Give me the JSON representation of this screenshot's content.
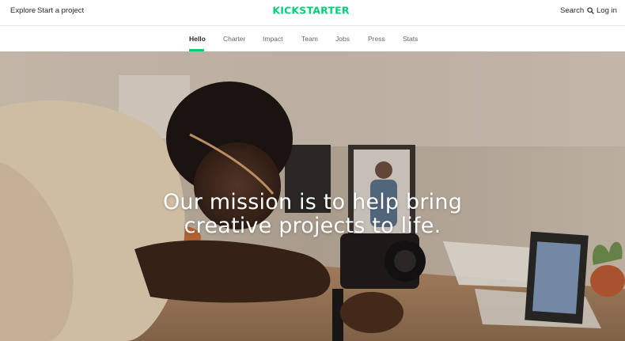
{
  "header": {
    "explore_label": "Explore",
    "start_project_label": "Start a project",
    "logo_text": "KICKSTARTER",
    "search_label": "Search",
    "login_label": "Log in"
  },
  "subnav": {
    "tabs": [
      {
        "label": "Hello",
        "active": true
      },
      {
        "label": "Charter",
        "active": false
      },
      {
        "label": "Impact",
        "active": false
      },
      {
        "label": "Team",
        "active": false
      },
      {
        "label": "Jobs",
        "active": false
      },
      {
        "label": "Press",
        "active": false
      },
      {
        "label": "Stats",
        "active": false
      }
    ]
  },
  "hero": {
    "line1": "Our mission is to help bring",
    "line2": "creative projects to life."
  },
  "colors": {
    "brand_green": "#05ce78",
    "text": "#282828",
    "muted": "#656969"
  },
  "icons": {
    "search": "search-icon"
  }
}
